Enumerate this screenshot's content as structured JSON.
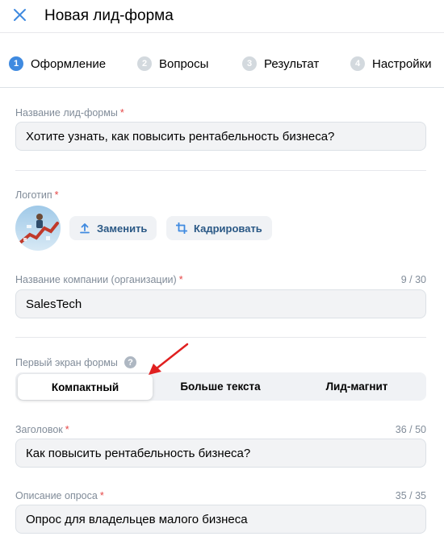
{
  "header": {
    "title": "Новая лид-форма",
    "close_icon": "close-icon"
  },
  "steps": [
    {
      "num": "1",
      "label": "Оформление"
    },
    {
      "num": "2",
      "label": "Вопросы"
    },
    {
      "num": "3",
      "label": "Результат"
    },
    {
      "num": "4",
      "label": "Настройки"
    }
  ],
  "form_name": {
    "label": "Название лид-формы",
    "required": "*",
    "value": "Хотите узнать, как повысить рентабельность бизнеса?"
  },
  "logo": {
    "label": "Логотип",
    "required": "*",
    "replace_label": "Заменить",
    "crop_label": "Кадрировать"
  },
  "company": {
    "label": "Название компании (организации)",
    "required": "*",
    "counter": "9 / 30",
    "value": "SalesTech"
  },
  "first_screen": {
    "label": "Первый экран формы",
    "help": "?",
    "options": [
      "Компактный",
      "Больше текста",
      "Лид-магнит"
    ],
    "selected": "Компактный"
  },
  "heading": {
    "label": "Заголовок",
    "required": "*",
    "counter": "36 / 50",
    "value": "Как повысить рентабельность бизнеса?"
  },
  "description": {
    "label": "Описание опроса",
    "required": "*",
    "counter": "35 / 35",
    "value": "Опрос для владельцев малого бизнеса"
  },
  "colors": {
    "accent": "#3f8ae0",
    "required": "#e64646",
    "annotation_arrow": "#e02020"
  }
}
